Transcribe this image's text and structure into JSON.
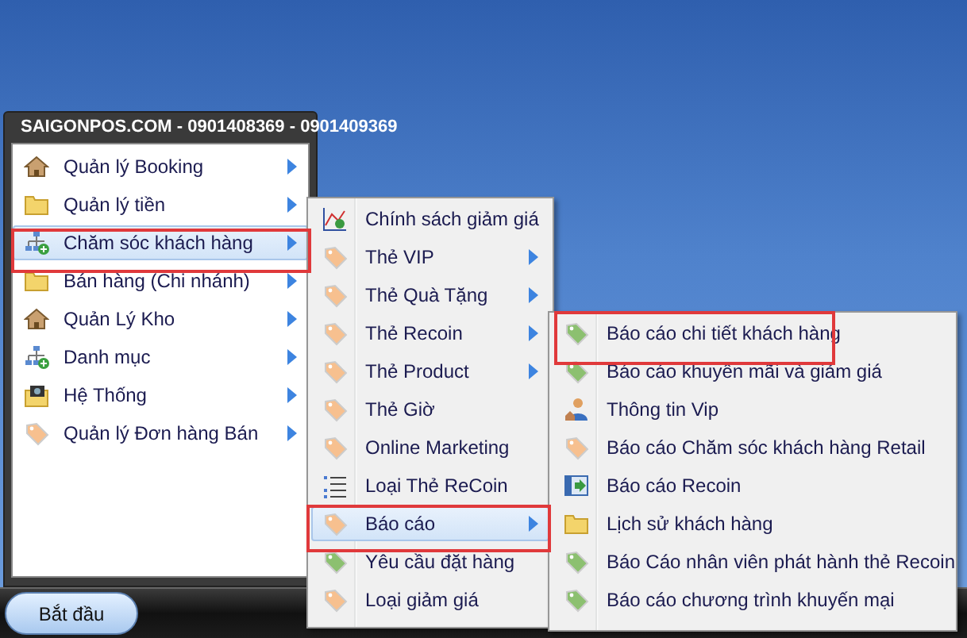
{
  "start_menu": {
    "title": "SAIGONPOS.COM - 0901408369 - 0901409369",
    "items": [
      {
        "label": "Quản lý Booking",
        "kind": "house",
        "submenu": true,
        "selected": false,
        "annotated": false
      },
      {
        "label": "Quản lý tiền",
        "kind": "folder",
        "submenu": true,
        "selected": false,
        "annotated": false
      },
      {
        "label": "Chăm sóc khách hàng",
        "kind": "network",
        "submenu": true,
        "selected": true,
        "annotated": true
      },
      {
        "label": "Bán hàng (Chi nhánh)",
        "kind": "folder",
        "submenu": true,
        "selected": false,
        "annotated": false
      },
      {
        "label": "Quản Lý Kho",
        "kind": "house",
        "submenu": true,
        "selected": false,
        "annotated": false
      },
      {
        "label": "Danh mục",
        "kind": "network",
        "submenu": true,
        "selected": false,
        "annotated": false
      },
      {
        "label": "Hệ Thống",
        "kind": "camera",
        "submenu": true,
        "selected": false,
        "annotated": false
      },
      {
        "label": "Quản lý Đơn hàng Bán",
        "kind": "tag",
        "submenu": true,
        "selected": false,
        "annotated": false
      }
    ]
  },
  "submenu": {
    "items": [
      {
        "label": "Chính sách giảm giá",
        "kind": "chart",
        "submenu": false,
        "selected": false,
        "annotated": false
      },
      {
        "label": "Thẻ VIP",
        "kind": "tag",
        "submenu": true,
        "selected": false,
        "annotated": false
      },
      {
        "label": "Thẻ Quà Tặng",
        "kind": "tag",
        "submenu": true,
        "selected": false,
        "annotated": false
      },
      {
        "label": "Thẻ Recoin",
        "kind": "tag",
        "submenu": true,
        "selected": false,
        "annotated": false
      },
      {
        "label": "Thẻ Product",
        "kind": "tag",
        "submenu": true,
        "selected": false,
        "annotated": false
      },
      {
        "label": "Thẻ Giờ",
        "kind": "tag",
        "submenu": false,
        "selected": false,
        "annotated": false
      },
      {
        "label": "Online Marketing",
        "kind": "tag",
        "submenu": false,
        "selected": false,
        "annotated": false
      },
      {
        "label": "Loại Thẻ ReCoin",
        "kind": "list",
        "submenu": false,
        "selected": false,
        "annotated": false
      },
      {
        "label": "Báo cáo",
        "kind": "tag",
        "submenu": true,
        "selected": true,
        "annotated": true
      },
      {
        "label": "Yêu cầu đặt hàng",
        "kind": "greentag",
        "submenu": false,
        "selected": false,
        "annotated": false
      },
      {
        "label": "Loại giảm giá",
        "kind": "tag",
        "submenu": false,
        "selected": false,
        "annotated": false
      }
    ]
  },
  "report_submenu": {
    "items": [
      {
        "label": "Báo cáo chi tiết khách hàng",
        "kind": "greentag",
        "submenu": false,
        "selected": false,
        "annotated": true
      },
      {
        "label": "Báo cáo khuyến mãi và giảm giá",
        "kind": "greentag",
        "submenu": false,
        "selected": false,
        "annotated": false
      },
      {
        "label": "Thông tin Vip",
        "kind": "person",
        "submenu": false,
        "selected": false,
        "annotated": false
      },
      {
        "label": "Báo cáo Chăm sóc khách hàng Retail",
        "kind": "tag",
        "submenu": false,
        "selected": false,
        "annotated": false
      },
      {
        "label": "Báo cáo Recoin",
        "kind": "window",
        "submenu": false,
        "selected": false,
        "annotated": false
      },
      {
        "label": "Lịch sử khách hàng",
        "kind": "folder",
        "submenu": false,
        "selected": false,
        "annotated": false
      },
      {
        "label": "Báo Cáo nhân viên phát hành thẻ Recoin",
        "kind": "greentag",
        "submenu": false,
        "selected": false,
        "annotated": false
      },
      {
        "label": "Báo cáo chương trình khuyến mại",
        "kind": "greentag",
        "submenu": false,
        "selected": false,
        "annotated": false
      }
    ]
  },
  "taskbar": {
    "start_button": "Bắt đầu"
  }
}
